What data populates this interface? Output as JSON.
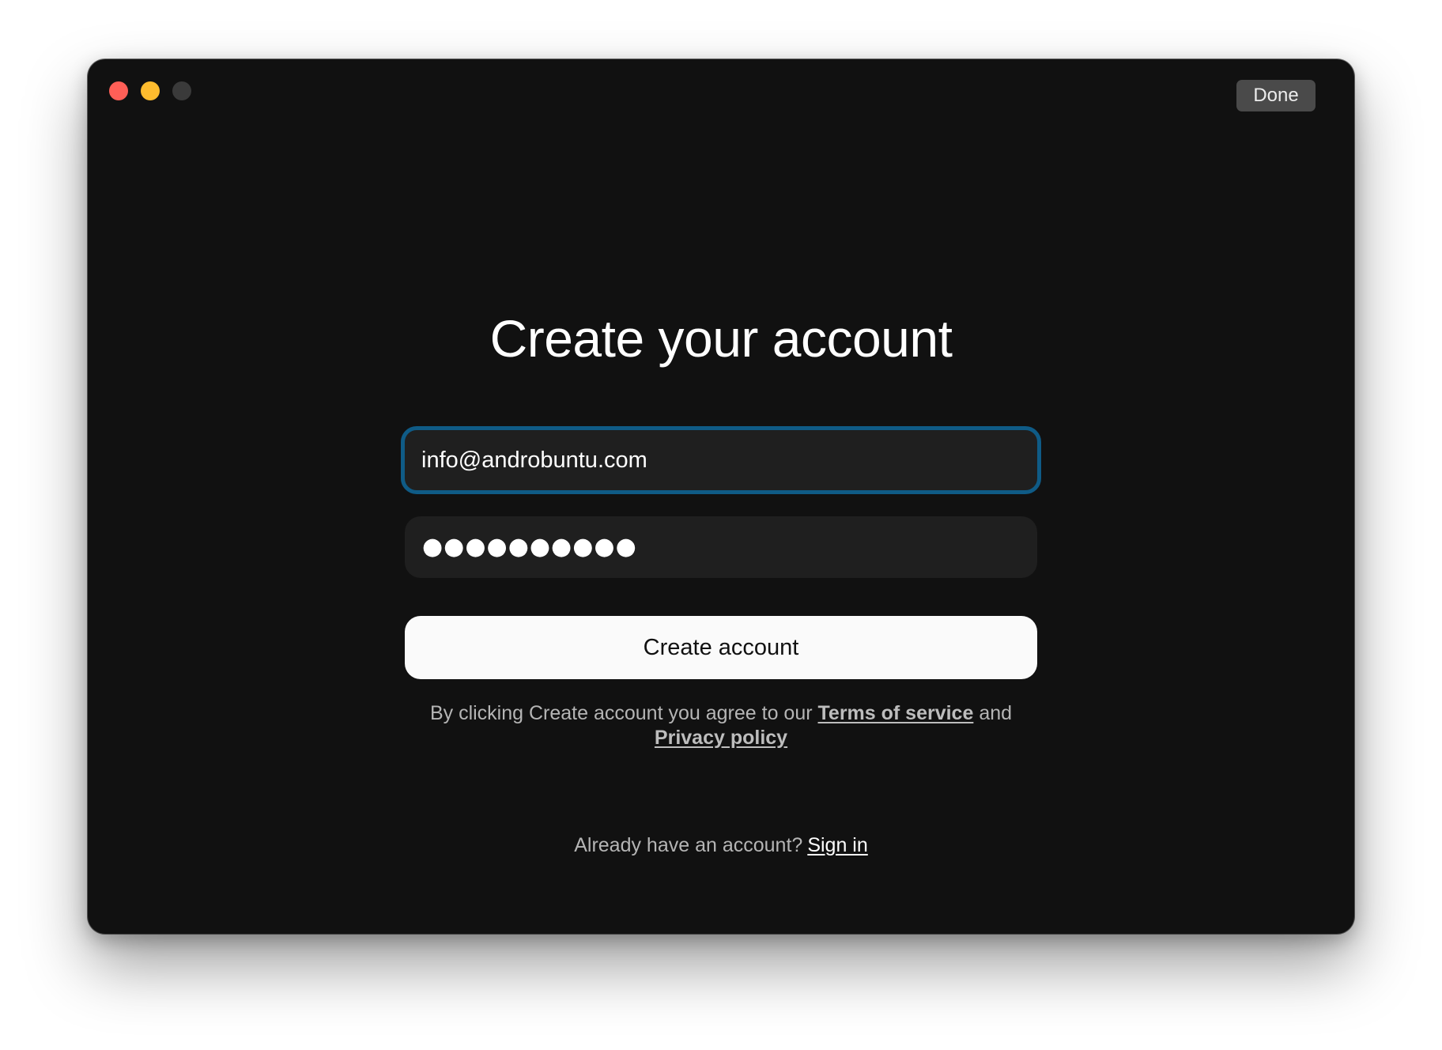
{
  "window": {
    "done_label": "Done",
    "traffic_lights": [
      "close-icon",
      "minimize-icon",
      "zoom-icon"
    ]
  },
  "form": {
    "title": "Create your account",
    "email_value": "info@androbuntu.com",
    "password_value": "●●●●●●●●●●",
    "submit_label": "Create account"
  },
  "legal": {
    "prefix": "By clicking Create account you agree to our",
    "terms_link": "Terms of service",
    "joiner": "and",
    "privacy_link": "Privacy policy"
  },
  "signin": {
    "prompt": "Already have an account?",
    "link": "Sign in"
  },
  "colors": {
    "window_bg": "#111111",
    "field_bg": "#1f1f1f",
    "focus_ring": "#0f5b86",
    "button_bg": "#fafafa",
    "close": "#ff5f57",
    "minimize": "#febc2e"
  }
}
